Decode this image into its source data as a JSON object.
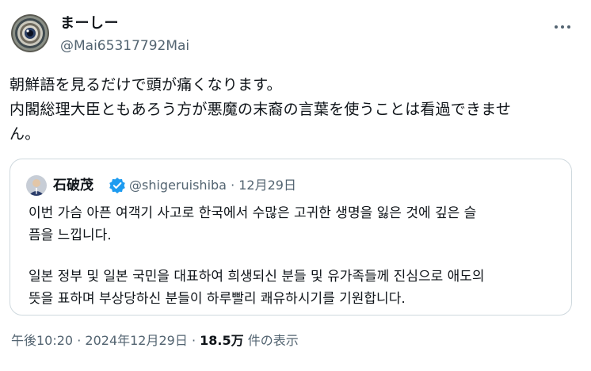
{
  "author": {
    "display_name": "まーしー",
    "handle": "@Mai65317792Mai",
    "avatar_icon": "eye-avatar-icon"
  },
  "more_icon": "more-options-icon",
  "tweet": {
    "lines": [
      "朝鮮語を見るだけで頭が痛くなります。",
      "内閣総理大臣ともあろう方が悪魔の末裔の言葉を使うことは看過できませ",
      "ん。"
    ]
  },
  "quoted": {
    "display_name": "石破茂",
    "verified_icon": "verified-badge-icon",
    "handle": "@shigeruishiba",
    "separator": "·",
    "date": "12月29日",
    "paragraph1": [
      "이번 가슴 아픈 여객기 사고로 한국에서 수많은 고귀한 생명을 잃은 것에 깊은 슬",
      "픔을 느낍니다."
    ],
    "paragraph2": [
      "일본 정부 및 일본 국민을 대표하여 희생되신 분들 및 유가족들께 진심으로 애도의",
      "뜻을 표하며 부상당하신 분들이 하루빨리 쾌유하시기를 기원합니다."
    ]
  },
  "footer": {
    "time": "午後10:20",
    "separator": "·",
    "date": "2024年12月29日",
    "views": "18.5万",
    "views_label": "件の表示"
  },
  "colors": {
    "text": "#0f1419",
    "secondary": "#536471",
    "border": "#cfd9de",
    "verified": "#1d9bf0"
  }
}
